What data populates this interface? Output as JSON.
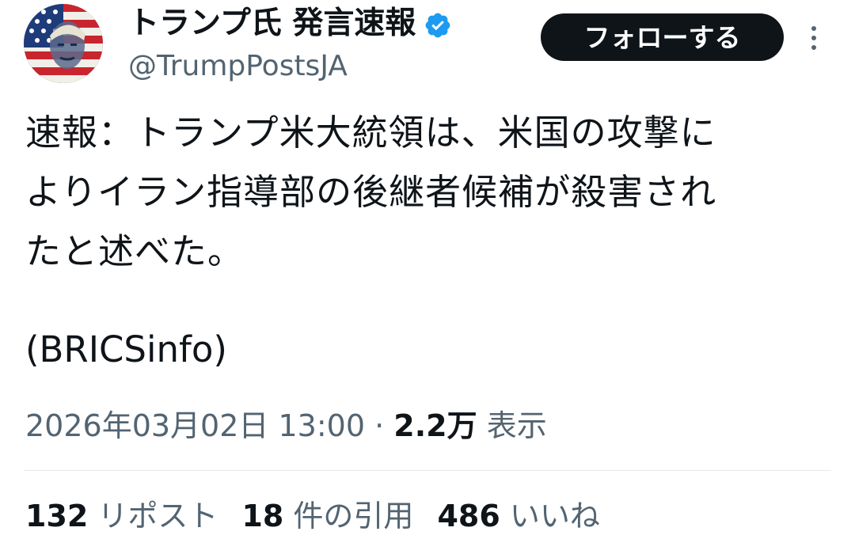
{
  "header": {
    "display_name": "トランプ氏 発言速報",
    "handle": "@TrumpPostsJA",
    "follow_label": "フォローする",
    "verified_color": "#1d9bf0"
  },
  "tweet": {
    "text": "速報：トランプ米大統領は、米国の攻撃に\nよりイラン指導部の後継者候補が殺害され\nたと述べた。",
    "source": "(BRICSinfo)",
    "timestamp": "2026年03月02日 13:00",
    "separator": "·",
    "views_count": "2.2万",
    "views_label": "表示"
  },
  "stats": {
    "reposts_count": "132",
    "reposts_label": "リポスト",
    "quotes_count": "18",
    "quotes_label": "件の引用",
    "likes_count": "486",
    "likes_label": "いいね"
  },
  "icons": {
    "avatar": "avatar-flag-portrait",
    "verified": "verified-badge-icon",
    "more": "more-vertical-icon"
  }
}
